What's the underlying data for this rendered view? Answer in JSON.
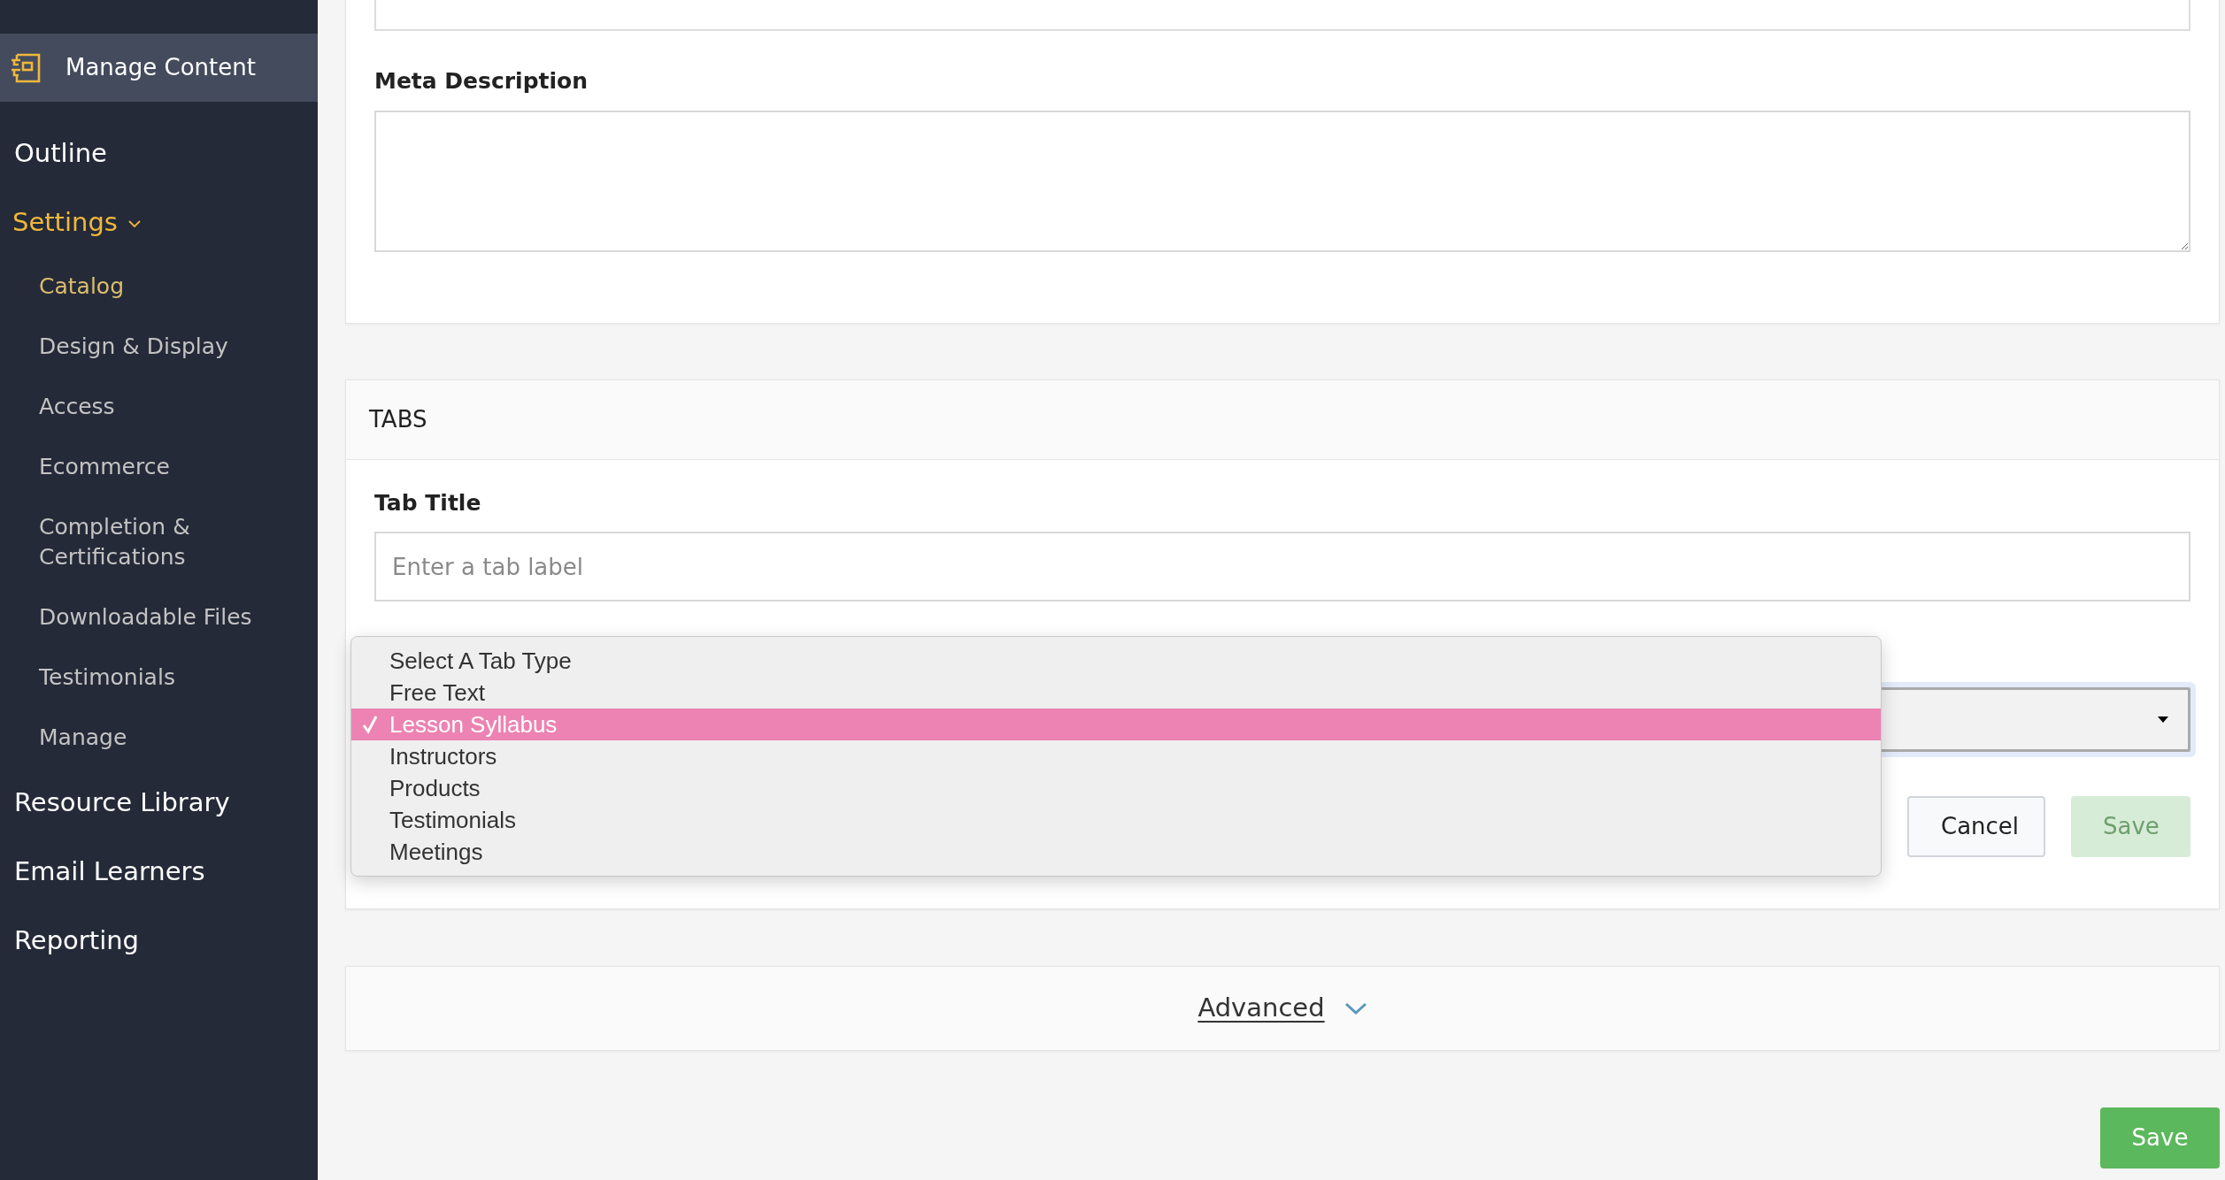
{
  "sidebar": {
    "header": {
      "label": "Manage Content"
    },
    "items": [
      {
        "label": "Outline",
        "selected": false
      },
      {
        "label": "Settings",
        "selected": true,
        "expanded": true,
        "children": [
          {
            "label": "Catalog",
            "selected": true
          },
          {
            "label": "Design & Display",
            "selected": false
          },
          {
            "label": "Access",
            "selected": false
          },
          {
            "label": "Ecommerce",
            "selected": false
          },
          {
            "label": "Completion & Certifications",
            "selected": false
          },
          {
            "label": "Downloadable Files",
            "selected": false
          },
          {
            "label": "Testimonials",
            "selected": false
          },
          {
            "label": "Manage",
            "selected": false
          }
        ]
      },
      {
        "label": "Resource Library",
        "selected": false
      },
      {
        "label": "Email Learners",
        "selected": false
      },
      {
        "label": "Reporting",
        "selected": false
      }
    ]
  },
  "meta_description": {
    "label": "Meta Description"
  },
  "tabs_section": {
    "title": "TABS",
    "tab_title": {
      "label": "Tab Title",
      "placeholder": "Enter a tab label"
    },
    "tab_type": {
      "expanded": true,
      "options": [
        {
          "label": "Select A Tab Type",
          "selected": false
        },
        {
          "label": "Free Text",
          "selected": false
        },
        {
          "label": "Lesson Syllabus",
          "selected": true
        },
        {
          "label": "Instructors",
          "selected": false
        },
        {
          "label": "Products",
          "selected": false
        },
        {
          "label": "Testimonials",
          "selected": false
        },
        {
          "label": "Meetings",
          "selected": false
        }
      ]
    },
    "buttons": [
      {
        "label": "Cancel",
        "kind": "secondary"
      },
      {
        "label": "Save",
        "kind": "primary",
        "disabled": true
      }
    ]
  },
  "advanced": {
    "label": "Advanced",
    "expanded": false
  },
  "save_button": {
    "label": "Save",
    "disabled": false
  }
}
